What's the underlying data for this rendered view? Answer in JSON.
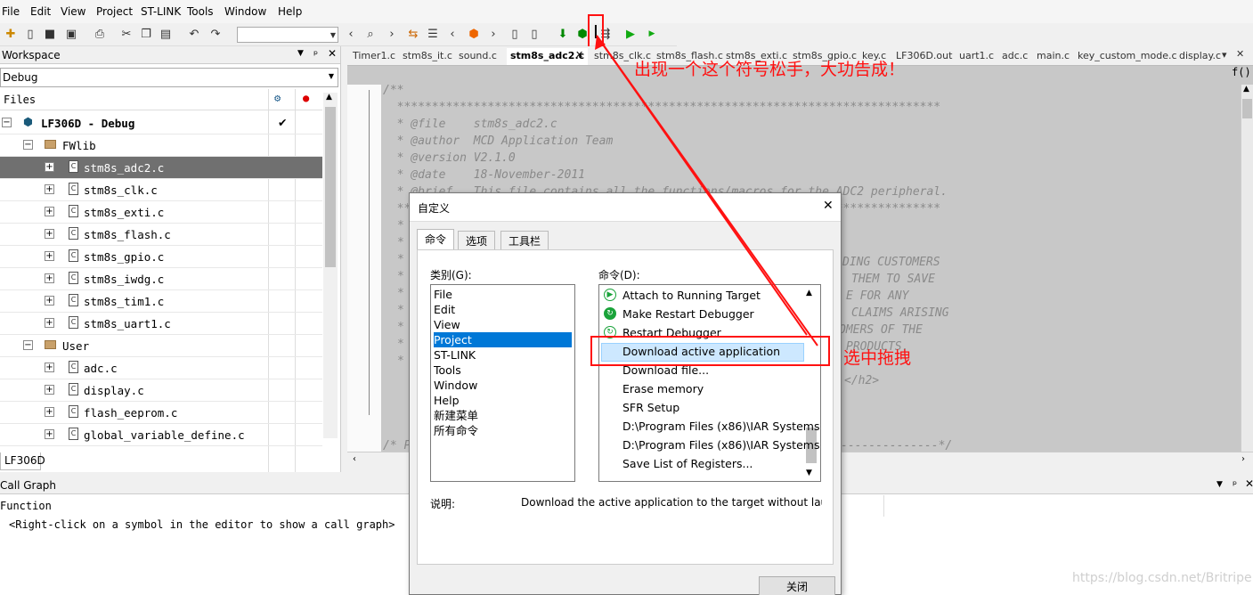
{
  "menu": {
    "items": [
      "File",
      "Edit",
      "View",
      "Project",
      "ST-LINK",
      "Tools",
      "Window",
      "Help"
    ]
  },
  "workspace": {
    "title": "Workspace",
    "config": "Debug",
    "files_header": "Files",
    "project": "LF306D - Debug",
    "groups": [
      {
        "name": "FWlib",
        "files": [
          "stm8s_adc2.c",
          "stm8s_clk.c",
          "stm8s_exti.c",
          "stm8s_flash.c",
          "stm8s_gpio.c",
          "stm8s_iwdg.c",
          "stm8s_tim1.c",
          "stm8s_uart1.c"
        ]
      },
      {
        "name": "User",
        "files": [
          "adc.c",
          "display.c",
          "flash_eeprom.c",
          "global_variable_define.c"
        ]
      }
    ],
    "bottom_tab": "LF306D"
  },
  "editor": {
    "tabs": [
      "Timer1.c",
      "stm8s_it.c",
      "sound.c",
      "stm8s_adc2.c",
      "stm8s_clk.c",
      "stm8s_flash.c",
      "stm8s_exti.c",
      "stm8s_gpio.c",
      "key.c",
      "LF306D.out",
      "uart1.c",
      "adc.c",
      "main.c",
      "key_custom_mode.c",
      "display.c"
    ],
    "active_tab": "stm8s_adc2.c",
    "lines": [
      "/**",
      "  ******************************************************************************",
      "  * @file    stm8s_adc2.c",
      "  * @author  MCD Application Team",
      "  * @version V2.1.0",
      "  * @date    18-November-2011",
      "  * @brief   This file contains all the functions/macros for the ADC2 peripheral.",
      "  ******************************************************************************"
    ],
    "right_fragments": [
      "DING CUSTOMERS",
      "THEM TO SAVE",
      "E FOR ANY",
      "CLAIMS ARISING",
      "OMERS OF THE",
      "PRODUCTS.",
      "</h2>"
    ],
    "bottom_comment": "/* P",
    "bottom_comment_end": "--------------*/"
  },
  "call_graph": {
    "title": "Call Graph",
    "column": "Function",
    "hint": "<Right-click on a symbol in the editor to show a call graph>"
  },
  "dialog": {
    "title": "自定义",
    "tabs": [
      "命令",
      "选项",
      "工具栏"
    ],
    "category_label": "类别(G):",
    "categories": [
      "File",
      "Edit",
      "View",
      "Project",
      "ST-LINK",
      "Tools",
      "Window",
      "Help",
      "新建菜单",
      "所有命令"
    ],
    "selected_category": "Project",
    "commands_label": "命令(D):",
    "commands": [
      "Attach to Running Target",
      "Make  Restart Debugger",
      "Restart Debugger",
      "Download active application",
      "Download file...",
      "Erase memory",
      "SFR Setup",
      "D:\\Program Files (x86)\\IAR Systems",
      "D:\\Program Files (x86)\\IAR Systems",
      "Save List of Registers..."
    ],
    "selected_command": "Download active application",
    "desc_label": "说明:",
    "description": "Download the active application to the target without laun",
    "close_button": "关闭"
  },
  "annotations": {
    "top": "出现一个这个符号松手，大功告成！",
    "drag": "选中拖拽",
    "color": "#ff1111"
  },
  "watermark": "https://blog.csdn.net/Britripe"
}
